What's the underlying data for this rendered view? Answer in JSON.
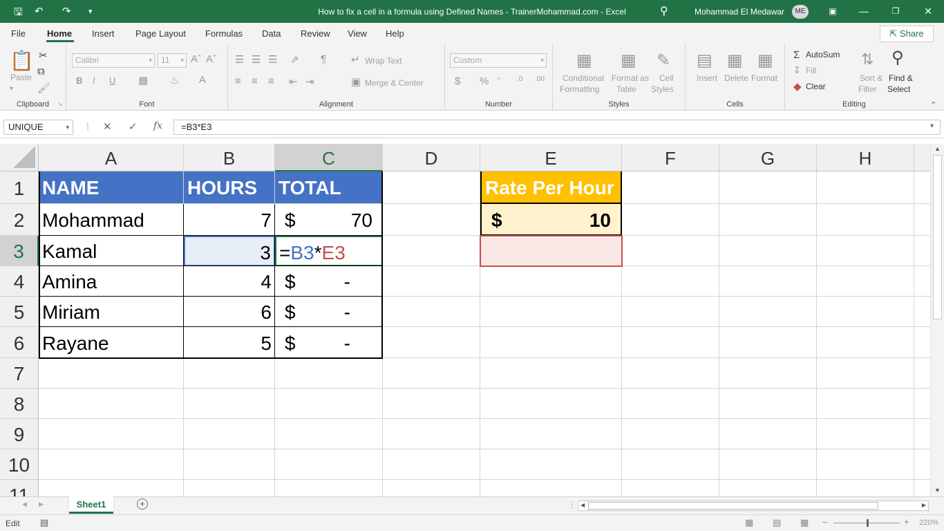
{
  "window": {
    "title": "How to fix a cell in a formula using Defined Names - TrainerMohammad.com  -  Excel",
    "user_name": "Mohammad El Medawar",
    "user_initials": "ME"
  },
  "menu": {
    "tabs": [
      "File",
      "Home",
      "Insert",
      "Page Layout",
      "Formulas",
      "Data",
      "Review",
      "View",
      "Help"
    ],
    "active": "Home",
    "share_label": "Share"
  },
  "ribbon": {
    "clipboard": {
      "paste": "Paste",
      "group": "Clipboard"
    },
    "font": {
      "name": "Calibri",
      "size": "11",
      "group": "Font"
    },
    "alignment": {
      "wrap": "Wrap Text",
      "merge": "Merge & Center",
      "group": "Alignment"
    },
    "number": {
      "format": "Custom",
      "group": "Number"
    },
    "styles": {
      "cond1": "Conditional",
      "cond2": "Formatting",
      "fmt1": "Format as",
      "fmt2": "Table",
      "cell1": "Cell",
      "cell2": "Styles",
      "group": "Styles"
    },
    "cells": {
      "insert": "Insert",
      "delete": "Delete",
      "format": "Format",
      "group": "Cells"
    },
    "editing": {
      "autosum": "AutoSum",
      "fill": "Fill",
      "clear": "Clear",
      "sort1": "Sort &",
      "sort2": "Filter",
      "find1": "Find &",
      "find2": "Select",
      "group": "Editing"
    }
  },
  "formula_bar": {
    "name_box": "UNIQUE",
    "formula": "=B3*E3",
    "fx": "fx"
  },
  "sheet": {
    "columns": [
      "A",
      "B",
      "C",
      "D",
      "E",
      "F",
      "G",
      "H"
    ],
    "selected_column": "C",
    "rows": [
      "1",
      "2",
      "3",
      "4",
      "5",
      "6",
      "7",
      "8",
      "9",
      "10",
      "11"
    ],
    "selected_row": "3",
    "headers": {
      "name": "NAME",
      "hours": "HOURS",
      "total": "TOTAL"
    },
    "data": [
      {
        "name": "Mohammad",
        "hours": "7",
        "currency": "$",
        "total": "70"
      },
      {
        "name": "Kamal",
        "hours": "3",
        "currency": "",
        "total": ""
      },
      {
        "name": "Amina",
        "hours": "4",
        "currency": "$",
        "total": "-"
      },
      {
        "name": "Miriam",
        "hours": "6",
        "currency": "$",
        "total": "-"
      },
      {
        "name": "Rayane",
        "hours": "5",
        "currency": "$",
        "total": "-"
      }
    ],
    "editing_formula": {
      "eq": "=",
      "ref1": "B3",
      "op": "*",
      "ref2": "E3"
    },
    "rate": {
      "label": "Rate Per Hour",
      "currency": "$",
      "value": "10"
    },
    "colors": {
      "header_blue": "#4472C4",
      "rate_orange": "#FFC000",
      "rate_fill": "#FFF2CC",
      "ref_blue": "#4472C4",
      "ref_red": "#C0504D",
      "excel_green": "#217346"
    }
  },
  "tabs": {
    "sheet1": "Sheet1",
    "add": "+"
  },
  "status": {
    "mode": "Edit",
    "zoom": "220%"
  }
}
